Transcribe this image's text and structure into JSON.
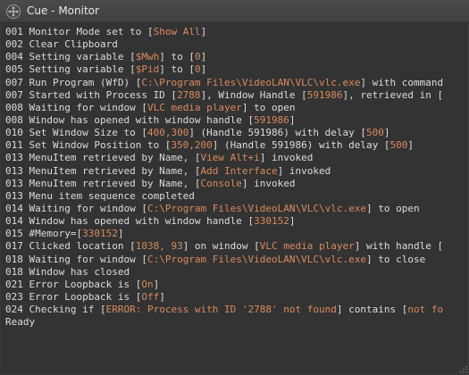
{
  "window": {
    "title": "Cue - Monitor",
    "title_icon": "move-arrows-icon"
  },
  "log": {
    "lines": [
      [
        {
          "t": "001 Monitor Mode set to ["
        },
        {
          "t": "Show All",
          "h": true
        },
        {
          "t": "]"
        }
      ],
      [
        {
          "t": "002 Clear Clipboard"
        }
      ],
      [
        {
          "t": "004 Setting variable ["
        },
        {
          "t": "$Mwh",
          "h": true
        },
        {
          "t": "] to ["
        },
        {
          "t": "0",
          "h": true
        },
        {
          "t": "]"
        }
      ],
      [
        {
          "t": "005 Setting variable ["
        },
        {
          "t": "$Pid",
          "h": true
        },
        {
          "t": "] to ["
        },
        {
          "t": "0",
          "h": true
        },
        {
          "t": "]"
        }
      ],
      [
        {
          "t": "007 Run Program (WfD) ["
        },
        {
          "t": "C:\\Program Files\\VideoLAN\\VLC\\vlc.exe",
          "h": true
        },
        {
          "t": "] with command"
        }
      ],
      [
        {
          "t": "007 Started with Process ID ["
        },
        {
          "t": "2788",
          "h": true
        },
        {
          "t": "], Window Handle ["
        },
        {
          "t": "591986",
          "h": true
        },
        {
          "t": "], retrieved in ["
        }
      ],
      [
        {
          "t": "008 Waiting for window ["
        },
        {
          "t": "VLC media player",
          "h": true
        },
        {
          "t": "] to open"
        }
      ],
      [
        {
          "t": "008 Window has opened with window handle ["
        },
        {
          "t": "591986",
          "h": true
        },
        {
          "t": "]"
        }
      ],
      [
        {
          "t": "010 Set Window Size to ["
        },
        {
          "t": "400,300",
          "h": true
        },
        {
          "t": "] (Handle 591986) with delay ["
        },
        {
          "t": "500",
          "h": true
        },
        {
          "t": "]"
        }
      ],
      [
        {
          "t": "011 Set Window Position to ["
        },
        {
          "t": "350,200",
          "h": true
        },
        {
          "t": "] (Handle 591986) with delay ["
        },
        {
          "t": "500",
          "h": true
        },
        {
          "t": "]"
        }
      ],
      [
        {
          "t": "013 MenuItem retrieved by Name, ["
        },
        {
          "t": "View Alt+i",
          "h": true
        },
        {
          "t": "] invoked"
        }
      ],
      [
        {
          "t": "013 MenuItem retrieved by Name, ["
        },
        {
          "t": "Add Interface",
          "h": true
        },
        {
          "t": "] invoked"
        }
      ],
      [
        {
          "t": "013 MenuItem retrieved by Name, ["
        },
        {
          "t": "Console",
          "h": true
        },
        {
          "t": "] invoked"
        }
      ],
      [
        {
          "t": "013 Menu item sequence completed"
        }
      ],
      [
        {
          "t": "014 Waiting for window ["
        },
        {
          "t": "C:\\Program Files\\VideoLAN\\VLC\\vlc.exe",
          "h": true
        },
        {
          "t": "] to open"
        }
      ],
      [
        {
          "t": "014 Window has opened with window handle ["
        },
        {
          "t": "330152",
          "h": true
        },
        {
          "t": "]"
        }
      ],
      [
        {
          "t": "015 #Memory=["
        },
        {
          "t": "330152",
          "h": true
        },
        {
          "t": "]"
        }
      ],
      [
        {
          "t": "017 Clicked location ["
        },
        {
          "t": "1038, 93",
          "h": true
        },
        {
          "t": "] on window ["
        },
        {
          "t": "VLC media player",
          "h": true
        },
        {
          "t": "] with handle ["
        }
      ],
      [
        {
          "t": "018 Waiting for window ["
        },
        {
          "t": "C:\\Program Files\\VideoLAN\\VLC\\vlc.exe",
          "h": true
        },
        {
          "t": "] to close"
        }
      ],
      [
        {
          "t": "018 Window has closed"
        }
      ],
      [
        {
          "t": "021 Error Loopback is ["
        },
        {
          "t": "On",
          "h": true
        },
        {
          "t": "]"
        }
      ],
      [
        {
          "t": "023 Error Loopback is ["
        },
        {
          "t": "Off",
          "h": true
        },
        {
          "t": "]"
        }
      ],
      [
        {
          "t": "024 Checking if ["
        },
        {
          "t": "ERROR: Process with ID '2788' not found",
          "h": true
        },
        {
          "t": "] contains ["
        },
        {
          "t": "not fo",
          "h": true
        }
      ],
      [
        {
          "t": "Ready"
        }
      ]
    ]
  },
  "colors": {
    "background": "#333333",
    "text": "#dcdcdc",
    "highlight": "#d98a5e"
  }
}
